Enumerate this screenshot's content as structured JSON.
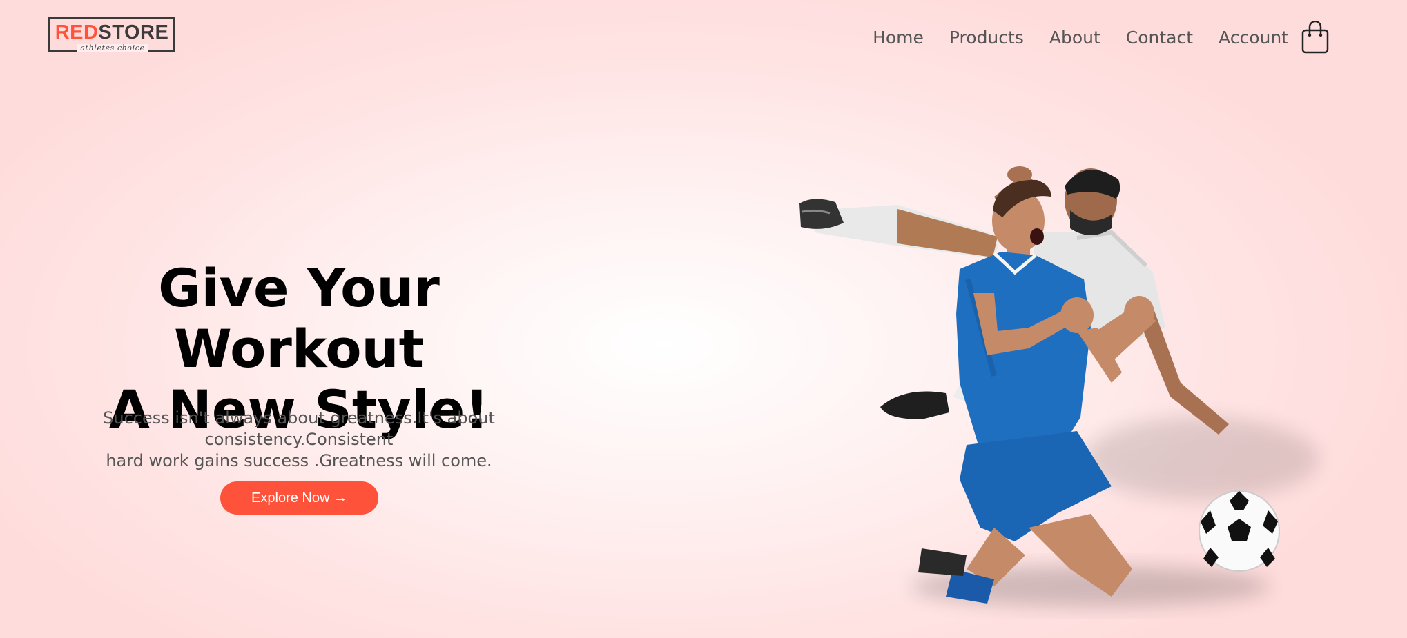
{
  "brand": {
    "part_red": "RED",
    "part_dark": "STORE",
    "tagline": "athletes choice",
    "accent_color": "#ff523b"
  },
  "nav": {
    "items": [
      {
        "label": "Home"
      },
      {
        "label": "Products"
      },
      {
        "label": "About"
      },
      {
        "label": "Contact"
      },
      {
        "label": "Account"
      }
    ],
    "cart_icon": "shopping-bag-icon"
  },
  "hero": {
    "title_line1": "Give Your Workout",
    "title_line2": "A New Style!",
    "description_line1": "Success isn't always about greatness.It's about consistency.Consistent",
    "description_line2": "hard work gains success .Greatness will come.",
    "cta_label": "Explore Now →",
    "image": "soccer-players-celebrating-image"
  }
}
